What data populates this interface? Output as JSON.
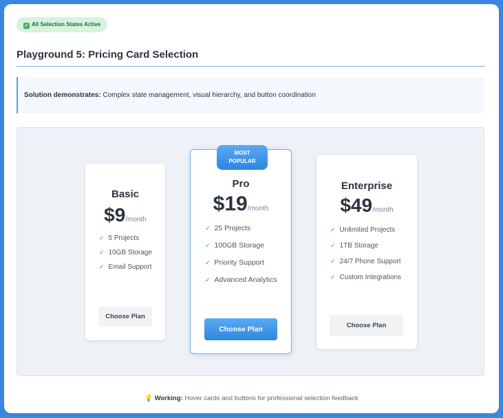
{
  "status_badge": {
    "check": "✓",
    "label": "All Selection States Active"
  },
  "page_title": "Playground 5: Pricing Card Selection",
  "note": {
    "label": "Solution demonstrates:",
    "text": "Complex state management, visual hierarchy, and button coordination"
  },
  "plans": [
    {
      "name": "Basic",
      "price": "$9",
      "period": "/month",
      "features": [
        "5 Projects",
        "10GB Storage",
        "Email Support"
      ],
      "button": "Choose Plan"
    },
    {
      "name": "Pro",
      "price": "$19",
      "period": "/month",
      "ribbon": [
        "MOST",
        "POPULAR"
      ],
      "features": [
        "25 Projects",
        "100GB Storage",
        "Priority Support",
        "Advanced Analytics"
      ],
      "button": "Choose Plan"
    },
    {
      "name": "Enterprise",
      "price": "$49",
      "period": "/month",
      "features": [
        "Unlimited Projects",
        "1TB Storage",
        "24/7 Phone Support",
        "Custom Integrations"
      ],
      "button": "Choose Plan"
    }
  ],
  "check_mark": "✓",
  "footer": {
    "icon": "💡",
    "label": "Working:",
    "text": "Hover cards and buttons for professional selection feedback"
  },
  "colors": {
    "accent": "#2e86e0",
    "frame": "#3a86e0",
    "success": "#2fa84f"
  }
}
